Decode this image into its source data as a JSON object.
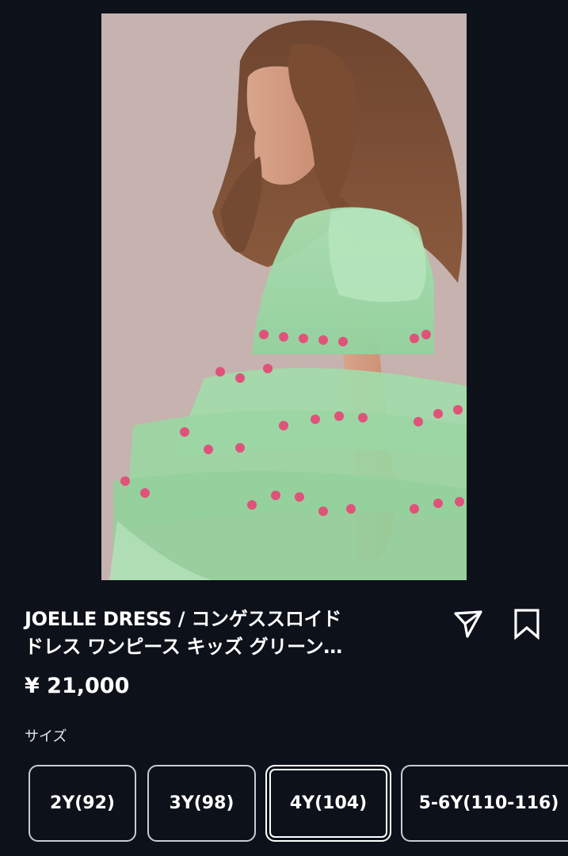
{
  "product": {
    "title_line1": "JOELLE DRESS / コンゲススロイド",
    "title_line2": "ドレス ワンピース キッズ グリーン…",
    "price": "¥ 21,000",
    "image_icon": "product-photo-girl-green-tulle-dress"
  },
  "actions": {
    "share_icon": "share-icon",
    "bookmark_icon": "bookmark-icon"
  },
  "sizes": {
    "label": "サイズ",
    "options": [
      "2Y(92)",
      "3Y(98)",
      "4Y(104)",
      "5-6Y(110-116)"
    ],
    "selected": "4Y(104)"
  },
  "colors": {
    "background": "#0d1119",
    "dress_green": "#9fd8a6",
    "flower_pink": "#e0527a"
  }
}
